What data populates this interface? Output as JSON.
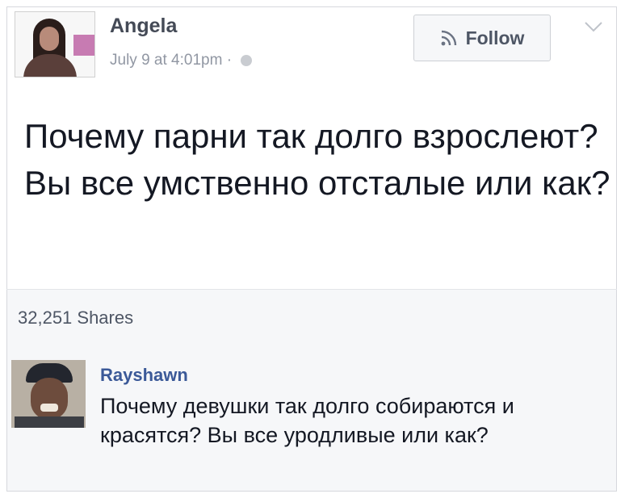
{
  "post": {
    "author": "Angela",
    "timestamp": "July 9 at 4:01pm ·",
    "follow_label": "Follow",
    "text": "Почему парни так долго взрослеют? Вы все умственно отсталые или как?"
  },
  "stats": {
    "shares": "32,251 Shares"
  },
  "comment": {
    "author": "Rayshawn",
    "text": "Почему девушки так долго собираются и красятся? Вы все уродливые или как?"
  },
  "colors": {
    "name_link": "#3b5998",
    "muted": "#9197a3",
    "footer_bg": "#f6f7f9"
  },
  "icons": {
    "follow": "rss-icon",
    "menu": "chevron-down-icon",
    "audience": "globe-icon"
  }
}
